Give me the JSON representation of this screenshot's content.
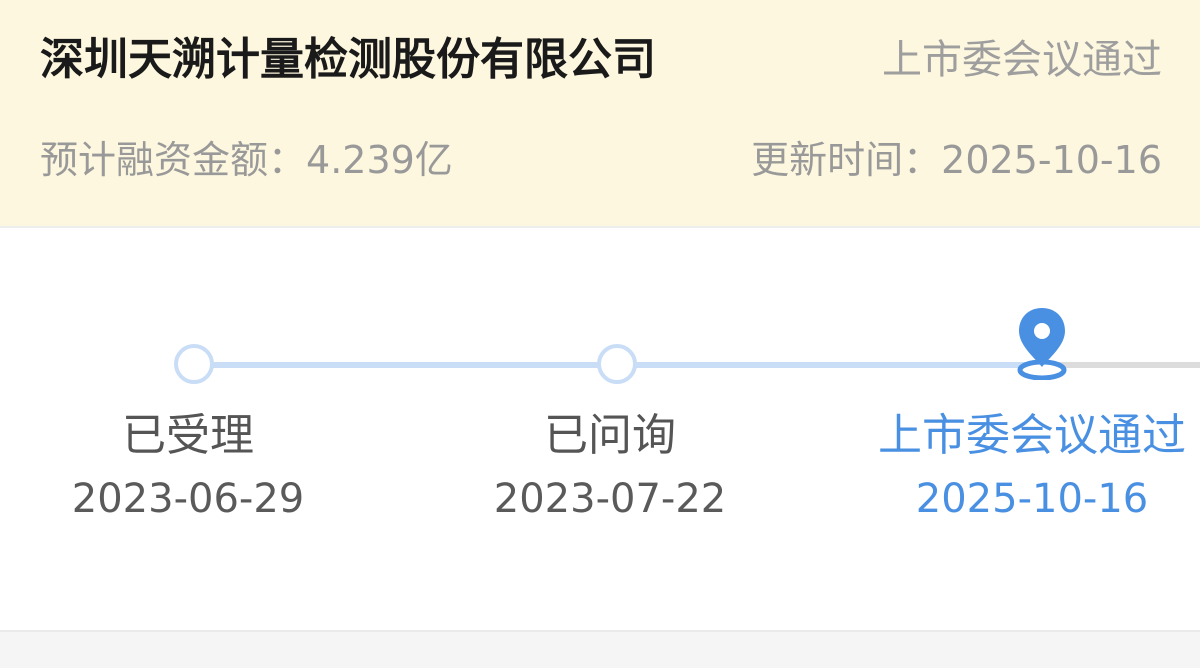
{
  "header": {
    "company_name": "深圳天溯计量检测股份有限公司",
    "status": "上市委会议通过",
    "financing_label": "预计融资金额：",
    "financing_value": "4.239亿",
    "updated_label": "更新时间：",
    "updated_value": "2025-10-16"
  },
  "timeline": {
    "progress": {
      "completed_steps": 3,
      "total_steps": 3
    },
    "steps": [
      {
        "label": "已受理",
        "date": "2023-06-29",
        "state": "done"
      },
      {
        "label": "已问询",
        "date": "2023-07-22",
        "state": "done"
      },
      {
        "label": "上市委会议通过",
        "date": "2025-10-16",
        "state": "current"
      }
    ]
  },
  "icons": {
    "current_step": "location-pin-icon",
    "done_step": "circle-node-icon"
  },
  "colors": {
    "header_bg": "#fdf7df",
    "accent": "#4a90e2",
    "track_done": "#c9ddf6",
    "track_todo": "#dcdcdc",
    "muted_text": "#999999"
  }
}
